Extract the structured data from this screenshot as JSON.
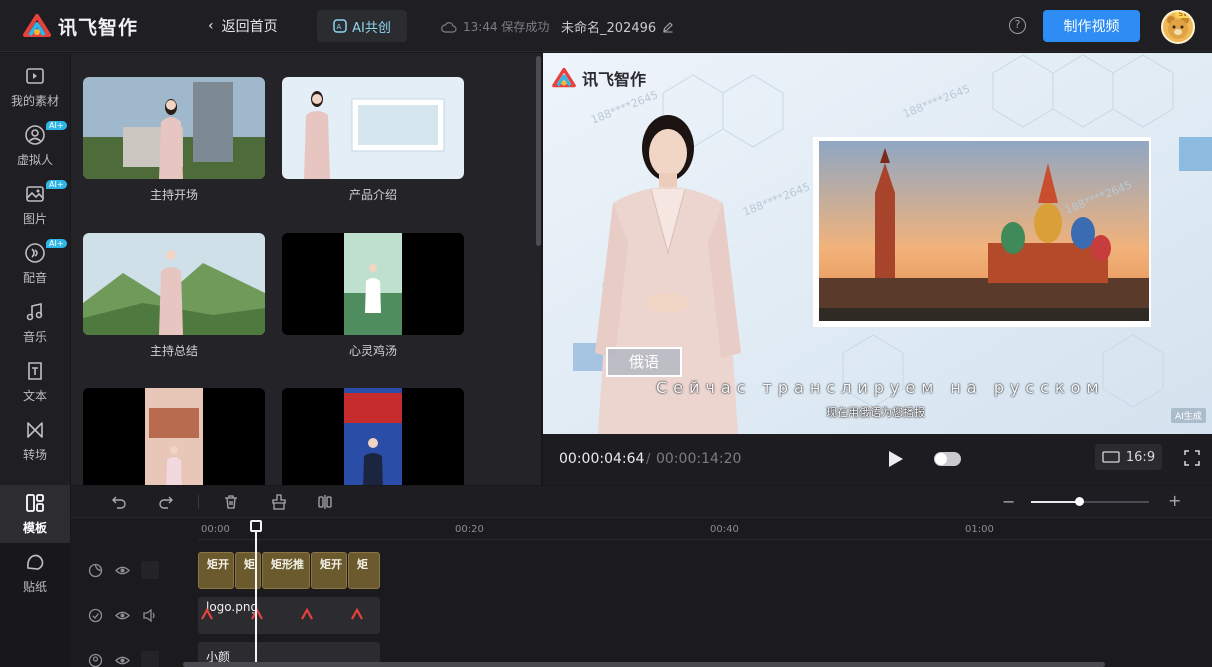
{
  "header": {
    "logo_text": "讯飞智作",
    "back_label": "返回首页",
    "ai_label": "AI共创",
    "save_status": "13:44 保存成功",
    "doc_name": "未命名_202496",
    "help": "?",
    "make_video_label": "制作视频",
    "vip_badge": "SVIP"
  },
  "sidebar": {
    "items": [
      {
        "label": "我的素材",
        "icon": "folder-icon"
      },
      {
        "label": "虚拟人",
        "icon": "person-icon",
        "badge": "AI+"
      },
      {
        "label": "图片",
        "icon": "image-icon",
        "badge": "AI+"
      },
      {
        "label": "配音",
        "icon": "voice-icon",
        "badge": "AI+"
      },
      {
        "label": "音乐",
        "icon": "music-icon"
      },
      {
        "label": "文本",
        "icon": "text-icon"
      },
      {
        "label": "转场",
        "icon": "transition-icon"
      },
      {
        "label": "模板",
        "icon": "template-icon"
      },
      {
        "label": "贴纸",
        "icon": "sticker-icon"
      }
    ]
  },
  "templates": [
    {
      "label": "主持开场"
    },
    {
      "label": "产品介绍"
    },
    {
      "label": "主持总结"
    },
    {
      "label": "心灵鸡汤"
    },
    {
      "label": ""
    },
    {
      "label": ""
    }
  ],
  "preview": {
    "logo_text": "讯飞智作",
    "watermark": "188****2645",
    "tag": "俄语",
    "subtitle_ru": "Сейчас транслируем на русском",
    "subtitle_cn": "现在用俄语为您播报",
    "ai_mark": "AI生成"
  },
  "controls": {
    "current_time": "00:00:04:64",
    "separator": "/",
    "total_time": "00:00:14:20",
    "ratio": "16:9"
  },
  "timeline": {
    "ticks": [
      "00:00",
      "00:20",
      "00:40",
      "01:00"
    ],
    "zoom_minus": "−",
    "zoom_plus": "+",
    "template_clips": [
      "矩开",
      "矩",
      "矩形推",
      "矩开",
      "矩"
    ],
    "logo_clip": "logo.png",
    "avatar_clip": "小颜"
  }
}
